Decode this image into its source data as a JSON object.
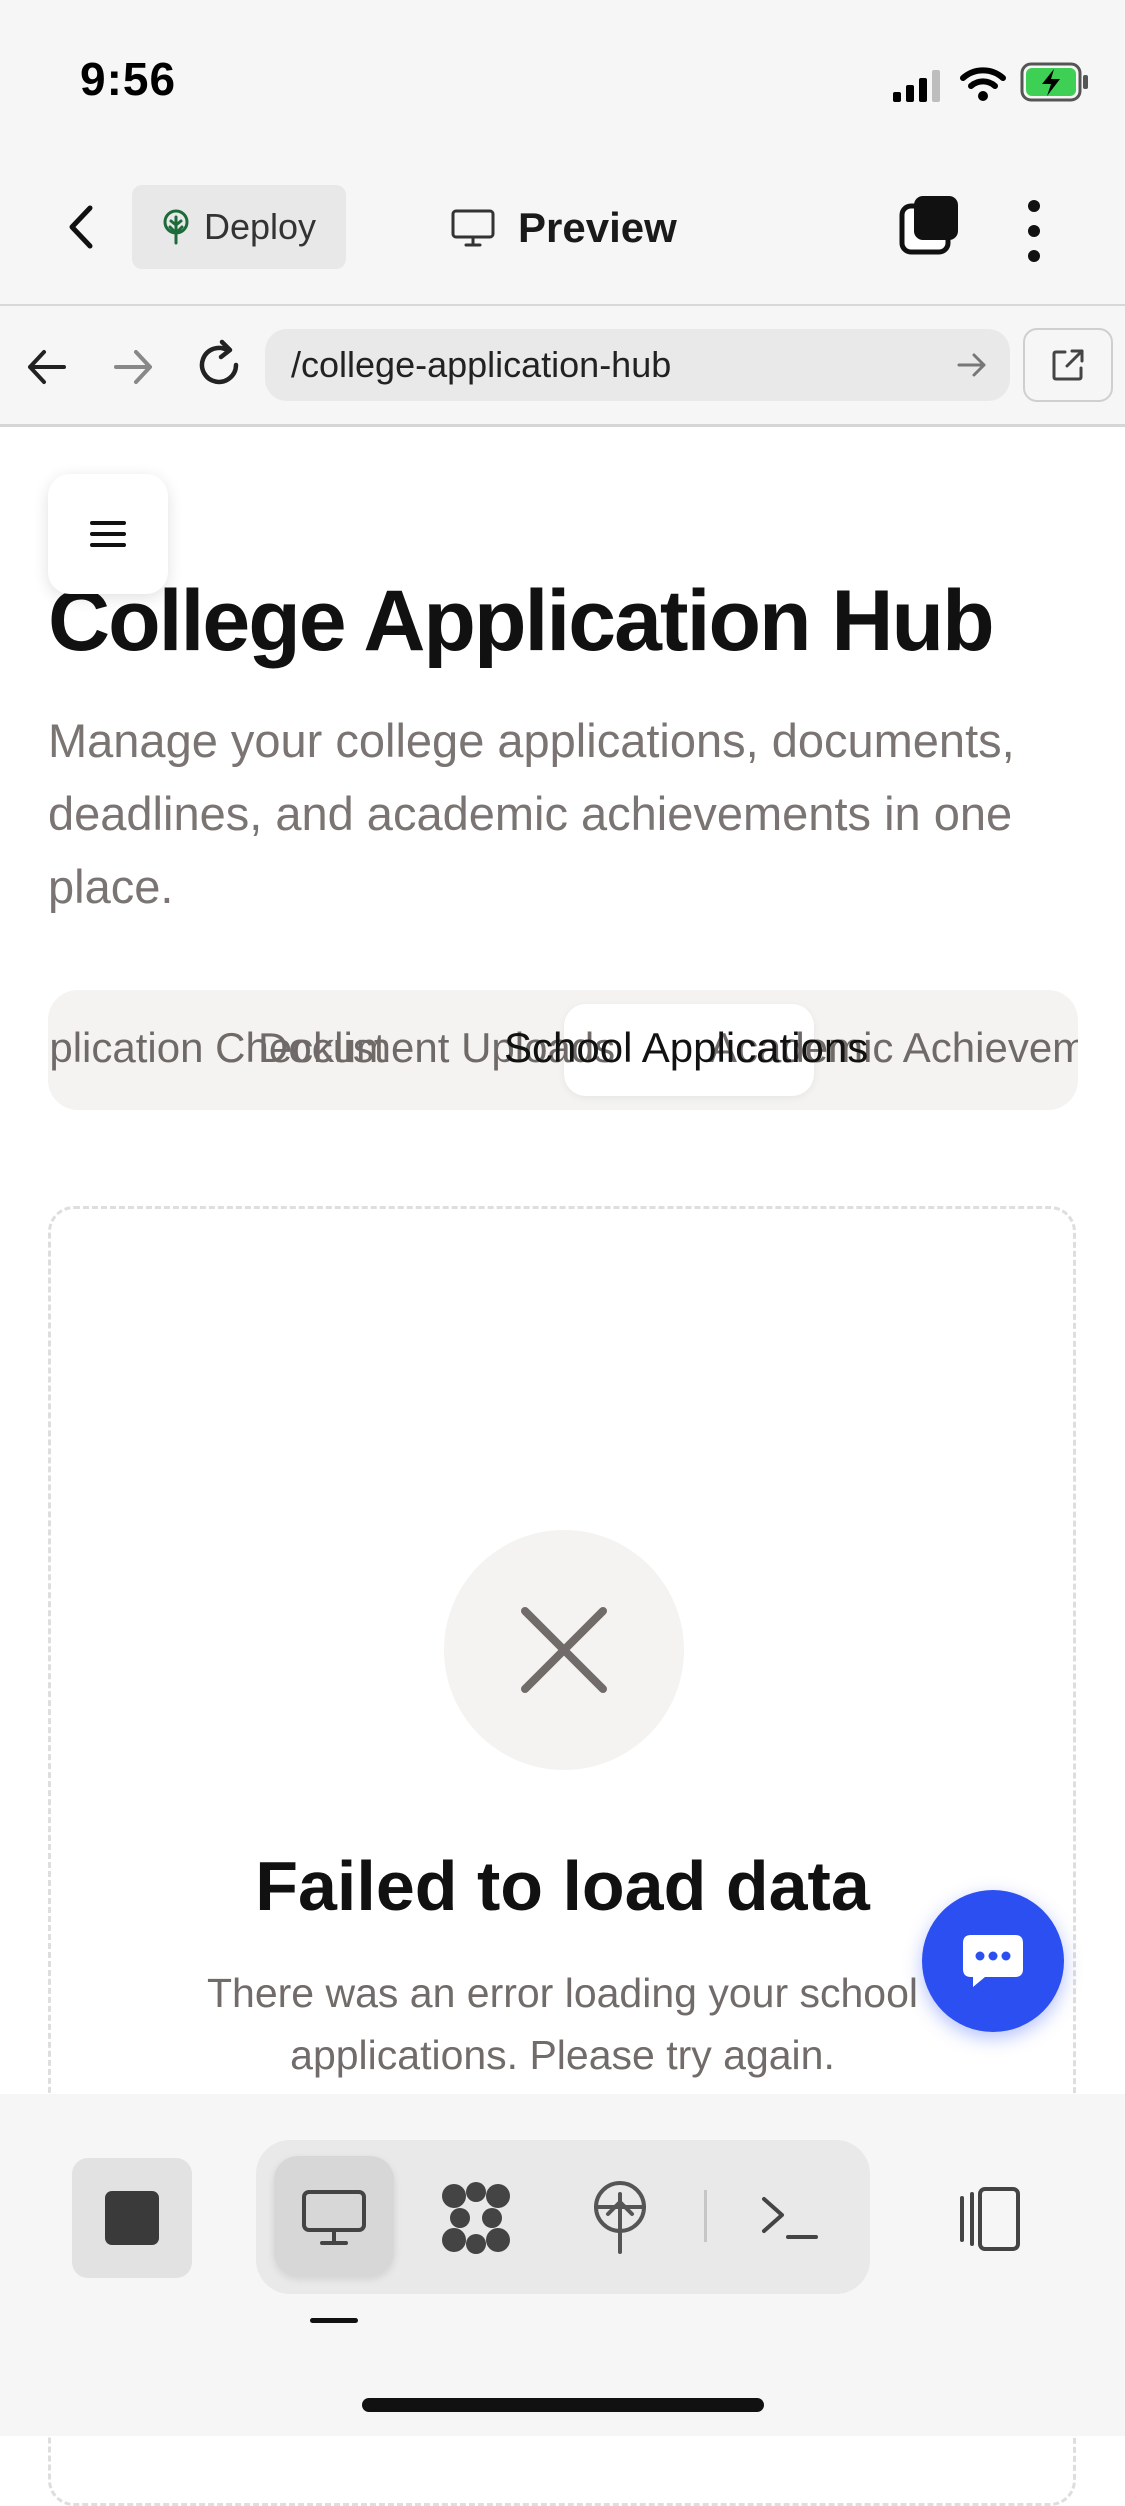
{
  "status_bar": {
    "time": "9:56"
  },
  "app_bar": {
    "deploy_label": "Deploy",
    "preview_label": "Preview"
  },
  "browser": {
    "url": "/college-application-hub"
  },
  "page": {
    "title": "College Application Hub",
    "description": "Manage your college applications, documents, deadlines, and academic achievements in one place.",
    "tabs": [
      {
        "label": "Application Checklist",
        "active": false
      },
      {
        "label": "Document Uploads",
        "active": false
      },
      {
        "label": "School Applications",
        "active": true
      },
      {
        "label": "Academic Achievements",
        "active": false
      }
    ],
    "error": {
      "title": "Failed to load data",
      "message": "There was an error loading your school applications. Please try again."
    }
  },
  "colors": {
    "accent": "#2c4ff2",
    "deploy_icon": "#1d6b3a"
  },
  "icons": {
    "back": "chevron-left-icon",
    "deploy": "tree-icon",
    "preview": "monitor-icon",
    "tabs": "tabs-stack-icon",
    "more": "more-vertical-icon",
    "menu": "hamburger-icon",
    "error": "x-icon",
    "chat": "chat-bubble-icon",
    "stop": "stop-icon",
    "desktop": "monitor-icon",
    "agent": "agent-icon",
    "deploy_tab": "deploy-icon",
    "terminal": "terminal-icon",
    "split": "split-view-icon"
  }
}
